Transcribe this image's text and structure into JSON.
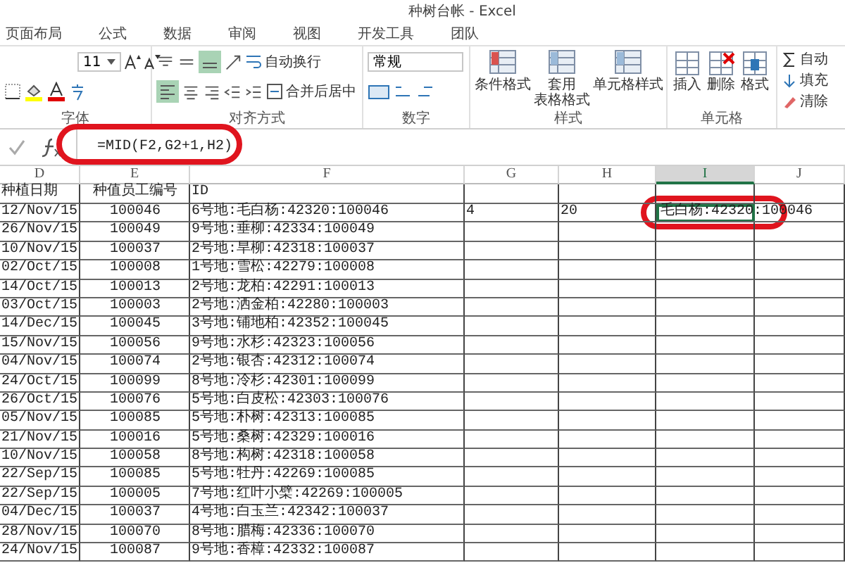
{
  "window": {
    "title": "种树台帐 - Excel"
  },
  "tabs": [
    {
      "label": "页面布局",
      "selected": false
    },
    {
      "label": "公式",
      "selected": false
    },
    {
      "label": "数据",
      "selected": false
    },
    {
      "label": "审阅",
      "selected": false
    },
    {
      "label": "视图",
      "selected": false
    },
    {
      "label": "开发工具",
      "selected": false
    },
    {
      "label": "团队",
      "selected": false
    }
  ],
  "ribbon": {
    "font": {
      "size": "11",
      "label": "字体"
    },
    "alignment": {
      "wrap": "自动换行",
      "merge": "合并后居中",
      "label": "对齐方式"
    },
    "number": {
      "format": "常规",
      "label": "数字"
    },
    "styles": {
      "label": "样式",
      "buttons": [
        {
          "lines": [
            "条件格式"
          ]
        },
        {
          "lines": [
            "套用",
            "表格格式"
          ]
        },
        {
          "lines": [
            "单元格样式"
          ]
        }
      ]
    },
    "cells": {
      "label": "单元格",
      "buttons": [
        "插入",
        "删除",
        "格式"
      ]
    },
    "editing": {
      "items": [
        "自动",
        "填充",
        "清除"
      ]
    }
  },
  "formula_bar": {
    "formula": "=MID(F2,G2+1,H2)"
  },
  "columns": [
    {
      "letter": "D",
      "selected": false
    },
    {
      "letter": "E",
      "selected": false
    },
    {
      "letter": "F",
      "selected": false
    },
    {
      "letter": "G",
      "selected": false
    },
    {
      "letter": "H",
      "selected": false
    },
    {
      "letter": "I",
      "selected": true
    },
    {
      "letter": "J",
      "selected": false
    }
  ],
  "header_row": [
    "种植日期",
    "种值员工编号",
    "ID"
  ],
  "rows": [
    {
      "selected": true,
      "cells": [
        "12/Nov/15",
        "100046",
        "6号地:毛白杨:42320:100046",
        "4",
        "20",
        "毛白杨:42320:100046"
      ]
    },
    {
      "selected": false,
      "cells": [
        "26/Nov/15",
        "100049",
        "9号地:垂柳:42334:100049"
      ]
    },
    {
      "selected": false,
      "cells": [
        "10/Nov/15",
        "100037",
        "2号地:旱柳:42318:100037"
      ]
    },
    {
      "selected": false,
      "cells": [
        "02/Oct/15",
        "100008",
        "1号地:雪松:42279:100008"
      ]
    },
    {
      "selected": false,
      "cells": [
        "14/Oct/15",
        "100013",
        "2号地:龙柏:42291:100013"
      ]
    },
    {
      "selected": false,
      "cells": [
        "03/Oct/15",
        "100003",
        "2号地:洒金柏:42280:100003"
      ]
    },
    {
      "selected": false,
      "cells": [
        "14/Dec/15",
        "100045",
        "3号地:铺地柏:42352:100045"
      ]
    },
    {
      "selected": false,
      "cells": [
        "15/Nov/15",
        "100056",
        "9号地:水杉:42323:100056"
      ]
    },
    {
      "selected": false,
      "cells": [
        "04/Nov/15",
        "100074",
        "2号地:银杏:42312:100074"
      ]
    },
    {
      "selected": false,
      "cells": [
        "24/Oct/15",
        "100099",
        "8号地:冷杉:42301:100099"
      ]
    },
    {
      "selected": false,
      "cells": [
        "26/Oct/15",
        "100076",
        "5号地:白皮松:42303:100076"
      ]
    },
    {
      "selected": false,
      "cells": [
        "05/Nov/15",
        "100085",
        "5号地:朴树:42313:100085"
      ]
    },
    {
      "selected": false,
      "cells": [
        "21/Nov/15",
        "100016",
        "5号地:桑树:42329:100016"
      ]
    },
    {
      "selected": false,
      "cells": [
        "10/Nov/15",
        "100058",
        "8号地:构树:42318:100058"
      ]
    },
    {
      "selected": false,
      "cells": [
        "22/Sep/15",
        "100085",
        "5号地:牡丹:42269:100085"
      ]
    },
    {
      "selected": false,
      "cells": [
        "22/Sep/15",
        "100005",
        "7号地:红叶小檗:42269:100005"
      ]
    },
    {
      "selected": false,
      "cells": [
        "04/Dec/15",
        "100037",
        "4号地:白玉兰:42342:100037"
      ]
    },
    {
      "selected": false,
      "cells": [
        "28/Nov/15",
        "100070",
        "8号地:腊梅:42336:100070"
      ]
    },
    {
      "selected": false,
      "cells": [
        "24/Nov/15",
        "100087",
        "9号地:香樟:42332:100087"
      ]
    }
  ]
}
